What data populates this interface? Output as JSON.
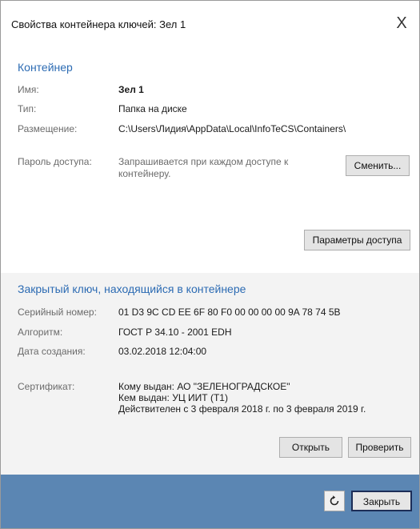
{
  "dialog": {
    "title": "Свойства контейнера ключей: Зел 1",
    "close_glyph": "X"
  },
  "container": {
    "heading": "Контейнер",
    "name_label": "Имя:",
    "name_value": "Зел 1",
    "type_label": "Тип:",
    "type_value": "Папка на диске",
    "location_label": "Размещение:",
    "location_value": "C:\\Users\\Лидия\\AppData\\Local\\InfoTeCS\\Containers\\",
    "password_label": "Пароль доступа:",
    "password_value_line1": "Запрашивается при каждом доступе к",
    "password_value_line2": "контейнеру.",
    "change_button": "Сменить...",
    "access_params_button": "Параметры доступа"
  },
  "private_key": {
    "heading": "Закрытый ключ, находящийся в контейнере",
    "serial_label": "Серийный номер:",
    "serial_value": "01 D3 9C CD EE 6F 80 F0 00 00 00 00 9A 78 74 5B",
    "algorithm_label": "Алгоритм:",
    "algorithm_value": "ГОСТ Р 34.10 - 2001 EDH",
    "created_label": "Дата создания:",
    "created_value": "03.02.2018 12:04:00",
    "certificate_label": "Сертификат:",
    "cert_issued_to": "Кому выдан: АО \"ЗЕЛЕНОГРАДСКОЕ\"",
    "cert_issued_by": "Кем выдан: УЦ ИИТ (Т1)",
    "cert_validity": "Действителен с 3 февраля 2018 г. по 3 февраля 2019 г.",
    "open_button": "Открыть",
    "verify_button": "Проверить"
  },
  "footer": {
    "refresh_icon": "refresh-icon",
    "close_button": "Закрыть"
  },
  "colors": {
    "accent": "#2c6bb3",
    "footer": "#5b86b3"
  }
}
